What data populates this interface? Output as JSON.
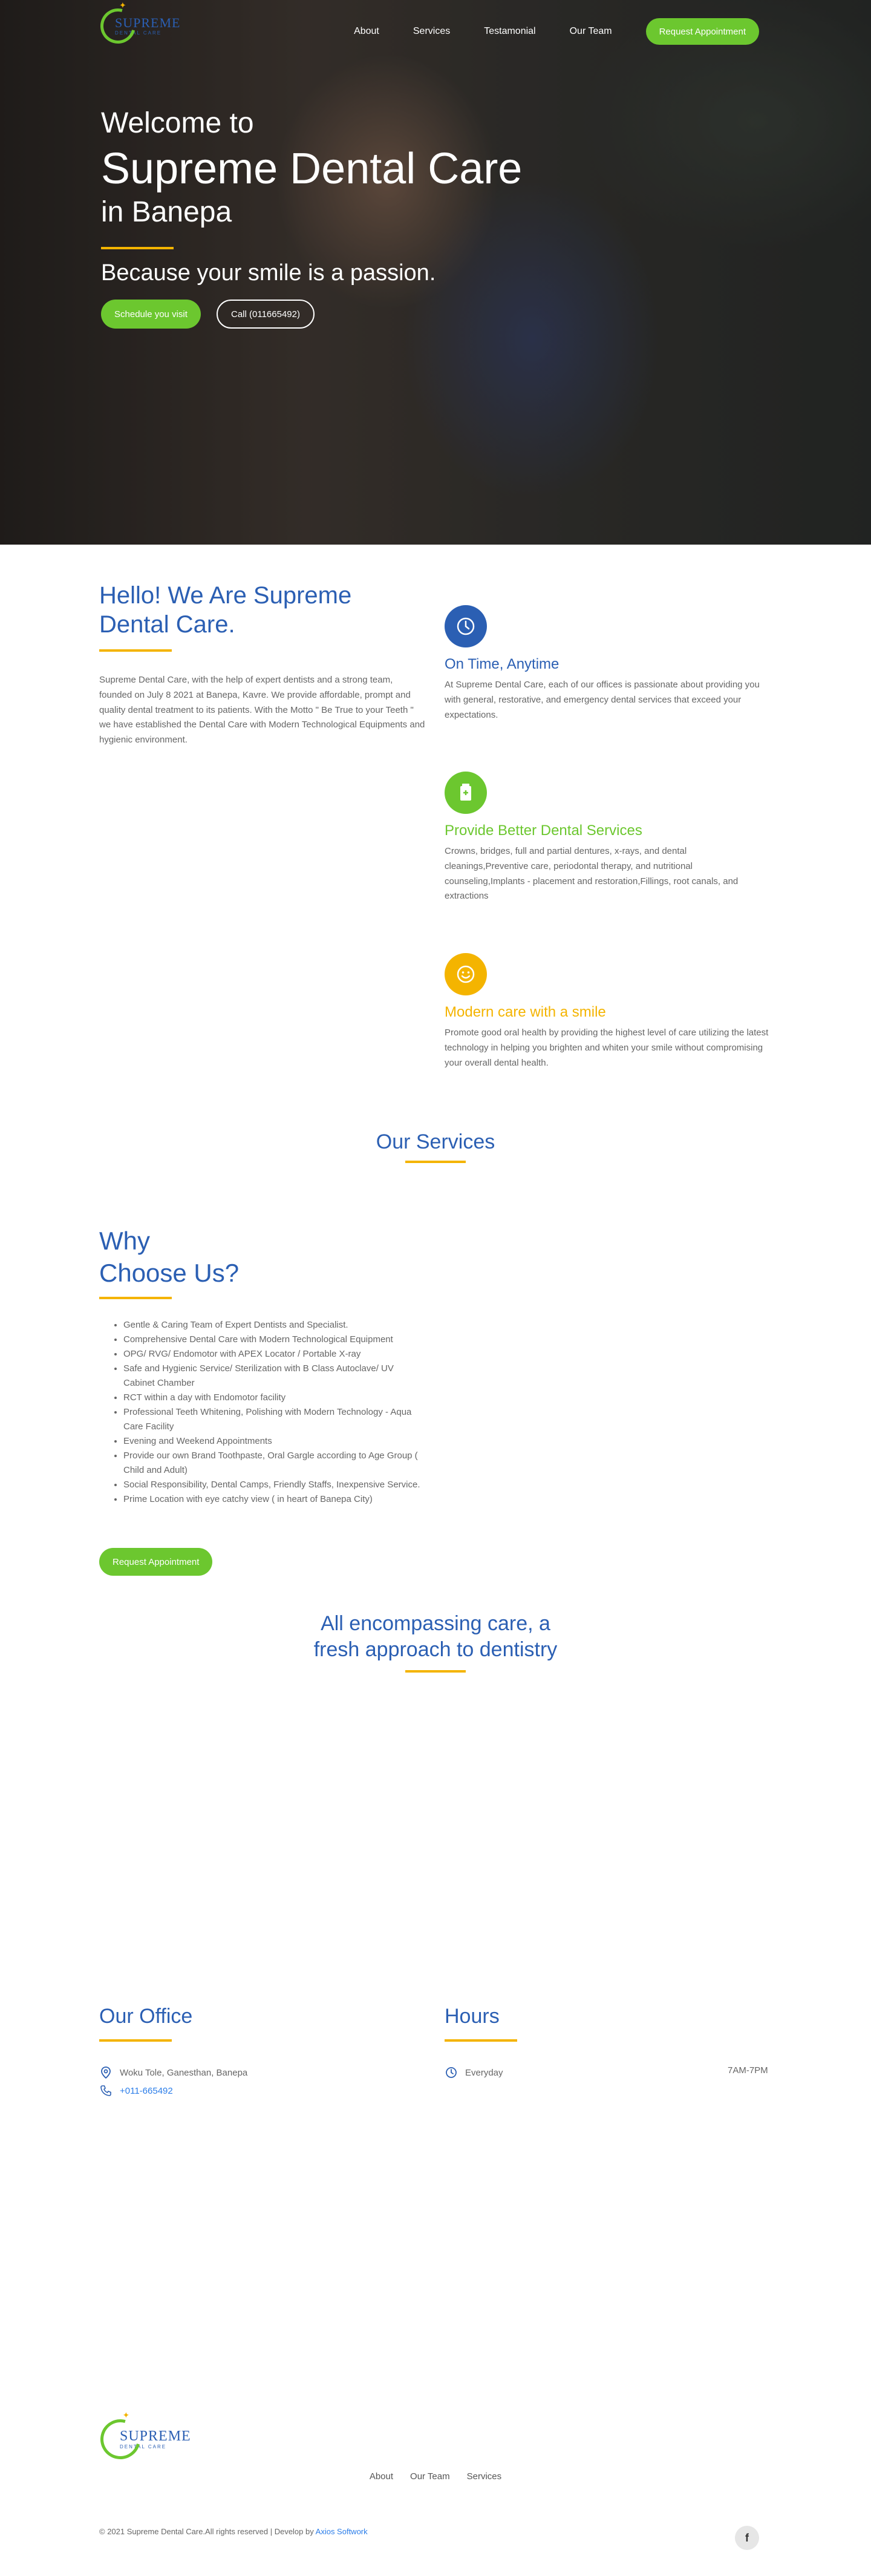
{
  "brand": {
    "name": "SUPREME",
    "sub": "DENTAL CARE"
  },
  "nav": {
    "items": [
      "About",
      "Services",
      "Testamonial",
      "Our Team"
    ],
    "cta": "Request Appointment"
  },
  "hero": {
    "welcome": "Welcome to",
    "title": "Supreme Dental Care",
    "location": "in Banepa",
    "tagline": "Because your smile is a passion.",
    "btn_schedule": "Schedule you visit",
    "btn_call": "Call (011665492)"
  },
  "about": {
    "title": "Hello! We Are Supreme Dental Care.",
    "text": "Supreme Dental Care, with the help of expert dentists and a strong team, founded on July 8 2021 at Banepa, Kavre. We provide affordable, prompt and quality dental treatment to its patients. With the Motto \" Be True to your Teeth \" we have established the Dental Care with Modern Technological Equipments and hygienic environment."
  },
  "features": [
    {
      "icon": "clock-icon",
      "color": "#2b5fb3",
      "title": "On Time, Anytime",
      "text": "At Supreme Dental Care, each of our offices is passionate about providing you with general, restorative, and emergency dental services that exceed your expectations."
    },
    {
      "icon": "medicine-icon",
      "color": "#6cc72f",
      "title": "Provide Better Dental Services",
      "text": "Crowns, bridges, full and partial dentures, x-rays, and dental cleanings,Preventive care, periodontal therapy, and nutritional counseling,Implants - placement and restoration,Fillings, root canals, and extractions"
    },
    {
      "icon": "smile-icon",
      "color": "#f4b400",
      "title": "Modern care with a smile",
      "text": "Promote good oral health by providing the highest level of care utilizing the latest technology in helping you brighten and whiten your smile without compromising your overall dental health."
    }
  ],
  "services": {
    "title": "Our Services"
  },
  "why": {
    "title_line1": "Why",
    "title_line2": "Choose Us?",
    "items": [
      "Gentle & Caring Team of Expert Dentists and Specialist.",
      "Comprehensive Dental Care with Modern Technological Equipment",
      "OPG/ RVG/ Endomotor with APEX Locator / Portable X-ray",
      "Safe and Hygienic Service/ Sterilization with B Class Autoclave/ UV Cabinet Chamber",
      "RCT within a day with Endomotor facility",
      "Professional Teeth Whitening, Polishing with Modern Technology - Aqua Care Facility",
      "Evening and Weekend Appointments",
      "Provide our own Brand Toothpaste, Oral Gargle according to Age Group ( Child and Adult)",
      "Social Responsibility, Dental Camps, Friendly Staffs, Inexpensive Service.",
      "Prime Location with eye catchy view ( in heart of Banepa City)"
    ],
    "cta": "Request Appointment"
  },
  "approach": {
    "line1": "All encompassing care, a",
    "line2": "fresh approach to dentistry"
  },
  "office": {
    "title": "Our Office",
    "address": "Woku Tole, Ganesthan, Banepa",
    "phone": "+011-665492"
  },
  "hours": {
    "title": "Hours",
    "day": "Everyday",
    "time": "7AM-7PM"
  },
  "footer": {
    "links": [
      "About",
      "Our Team",
      "Services"
    ],
    "copyright": "© 2021 Supreme Dental Care.All rights reserved | Develop by",
    "developer": "Axios Softwork"
  }
}
